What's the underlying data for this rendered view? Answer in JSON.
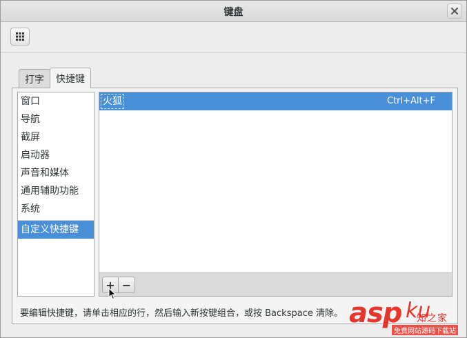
{
  "window": {
    "title": "键盘"
  },
  "tabs": [
    {
      "label": "打字",
      "active": false
    },
    {
      "label": "快捷键",
      "active": true
    }
  ],
  "categories": [
    {
      "label": "窗口",
      "selected": false
    },
    {
      "label": "导航",
      "selected": false
    },
    {
      "label": "截屏",
      "selected": false
    },
    {
      "label": "启动器",
      "selected": false
    },
    {
      "label": "声音和媒体",
      "selected": false
    },
    {
      "label": "通用辅助功能",
      "selected": false
    },
    {
      "label": "系统",
      "selected": false
    },
    {
      "label": "自定义快捷键",
      "selected": true
    }
  ],
  "shortcuts": [
    {
      "name": "火狐",
      "accelerator": "Ctrl+Alt+F",
      "selected": true
    }
  ],
  "shortcut_toolbar": {
    "add_label": "+",
    "remove_label": "−"
  },
  "hint_text": "要编辑快捷键，请单击相应的行，然后输入新按键组合，或按 Backspace 清除。",
  "watermark": {
    "brand": "asp",
    "brand_suffix": "ku",
    "cn_text": "知之家",
    "sub_text": "免费网站源码下载站"
  },
  "colors": {
    "selection": "#4a90d9",
    "window_bg": "#ededed",
    "watermark_red": "#e8352b"
  },
  "icons": {
    "overview_button": "grid-icon",
    "close_button": "close-icon",
    "pointer": "mouse-pointer-icon"
  }
}
